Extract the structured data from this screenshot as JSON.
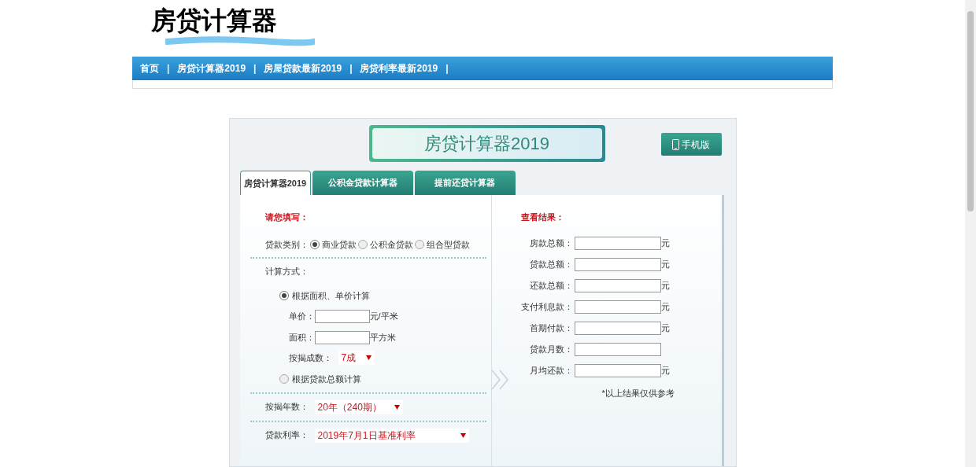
{
  "logo": {
    "title": "房贷计算器"
  },
  "nav": {
    "separator": "|",
    "items": [
      {
        "label": "首页"
      },
      {
        "label": "房贷计算器2019"
      },
      {
        "label": "房屋贷款最新2019"
      },
      {
        "label": "房贷利率最新2019"
      }
    ]
  },
  "calculator": {
    "title": "房贷计算器2019",
    "mobile_button": "手机版",
    "tabs": [
      {
        "label": "房贷计算器2019",
        "selected": true
      },
      {
        "label": "公积金贷款计算器",
        "selected": false
      },
      {
        "label": "提前还贷计算器",
        "selected": false
      }
    ],
    "input": {
      "heading": "请您填写：",
      "loan_type": {
        "label": "贷款类别：",
        "options": [
          {
            "label": "商业贷款",
            "selected": true
          },
          {
            "label": "公积金贷款",
            "selected": false
          },
          {
            "label": "组合型贷款",
            "selected": false
          }
        ]
      },
      "method": {
        "label": "计算方式：",
        "by_area": {
          "label": "根据面积、单价计算",
          "selected": true,
          "fields": [
            {
              "label": "单价：",
              "unit": "元/平米"
            },
            {
              "label": "面积：",
              "unit": "平方米"
            }
          ],
          "ratio": {
            "label": "按揭成数：",
            "value": "7成"
          }
        },
        "by_total": {
          "label": "根据贷款总额计算",
          "selected": false
        }
      },
      "years": {
        "label": "按揭年数：",
        "value": "20年（240期）"
      },
      "rate": {
        "label": "贷款利率：",
        "value": "2019年7月1日基准利率"
      }
    },
    "results": {
      "heading": "查看结果：",
      "fields": [
        {
          "label": "房款总额：",
          "unit": "元"
        },
        {
          "label": "贷款总额：",
          "unit": "元"
        },
        {
          "label": "还款总额：",
          "unit": "元"
        },
        {
          "label": "支付利息款：",
          "unit": "元"
        },
        {
          "label": "首期付款：",
          "unit": "元"
        },
        {
          "label": "贷款月数："
        },
        {
          "label": "月均还款：",
          "unit": "元"
        }
      ],
      "note": "*以上结果仅供参考"
    }
  }
}
